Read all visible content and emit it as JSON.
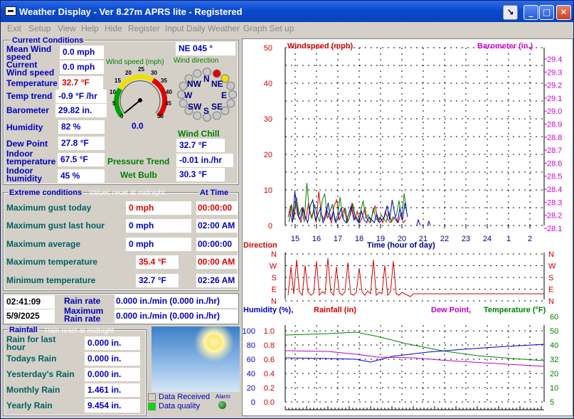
{
  "window": {
    "title": "Weather Display - Ver 8.27m APRS lite - Registered"
  },
  "menu": [
    "Exit",
    "Setup",
    "View",
    "Help",
    "Hide",
    "Register",
    "Input Daily Weather",
    "Graph Set up"
  ],
  "current": {
    "title": "Current Conditions",
    "mean_label": "Mean Wind speed",
    "mean": "0.0 mph",
    "current_label": "Current Wind speed",
    "current": "0.0 mph",
    "temp_label": "Temperature",
    "temp": "32.7 °F",
    "trend_label": "Temp trend",
    "trend": "-0.9 °F /hr",
    "baro_label": "Barometer",
    "baro": "29.82 in.",
    "hum_label": "Humidity",
    "hum": "82 %",
    "dew_label": "Dew Point",
    "dew": "27.8 °F",
    "itemp_label": "Indoor temperature",
    "itemp": "67.5 °F",
    "ihum_label": "Indoor humidity",
    "ihum": "45 %",
    "dir_value": "NE  045 °",
    "gauge_title": "Wind speed (mph)",
    "gauge_ticks": [
      "0",
      "5",
      "10",
      "15",
      "20",
      "25",
      "30",
      "35",
      "40",
      "45",
      "50"
    ],
    "gauge_value": "0.0",
    "dir_title": "Wind direction",
    "compass": [
      "N",
      "NE",
      "E",
      "SE",
      "S",
      "SW",
      "W",
      "NW"
    ],
    "chill_label": "Wind Chill",
    "chill": "32.7 °F",
    "ptrend_label": "Pressure Trend",
    "ptrend": "-0.01 in./hr",
    "wetbulb_label": "Wet Bulb",
    "wetbulb": "30.3 °F"
  },
  "extreme": {
    "title": "Extreme conditions",
    "note": "Values reset at midnight",
    "at_time": "At Time",
    "rows": [
      {
        "label": "Maximum gust today",
        "value": "0 mph",
        "time": "00:00:00",
        "vred": true,
        "tred": true
      },
      {
        "label": "Maximum gust last hour",
        "value": "0 mph",
        "time": "02:00 AM",
        "vred": false,
        "tred": false
      },
      {
        "label": "Maximum average",
        "value": "0 mph",
        "time": "00:00:00",
        "vred": false,
        "tred": false
      },
      {
        "label": "Maximum temperature",
        "value": "35.4 °F",
        "time": "00:00 AM",
        "vred": true,
        "tred": true
      },
      {
        "label": "Minimum temperature",
        "value": "32.7 °F",
        "time": "02:26 AM",
        "vred": false,
        "tred": false
      }
    ]
  },
  "clock": {
    "time": "02:41:09",
    "date": "5/9/2025"
  },
  "rainrate": {
    "label": "Rain rate",
    "value": "0.000 in./min (0.000 in./hr)",
    "max_label": "Maximum Rain rate",
    "max": "0.000 in./min (0.000 in./hr)"
  },
  "rainfall": {
    "title": "Rainfall",
    "note": "Rain reset at midnight",
    "rows": [
      {
        "label": "Rain for last hour",
        "value": "0.000 in."
      },
      {
        "label": "Todays Rain",
        "value": "0.000 in."
      },
      {
        "label": "Yesterday's Rain",
        "value": "0.000 in."
      },
      {
        "label": "Monthly Rain",
        "value": "1.461 in."
      },
      {
        "label": "Yearly Rain",
        "value": "9.454 in."
      }
    ]
  },
  "status": {
    "received": "Data Received",
    "quality": "Data quality",
    "alarm": "Alarm"
  },
  "graph": {
    "wind_label": "Windspeed (mph)",
    "baro_label": "Barometer (in.)",
    "wind_ticks": [
      "50",
      "40",
      "30",
      "20",
      "10",
      "0"
    ],
    "baro_ticks": [
      "29.4",
      "29.3",
      "29.2",
      "29.1",
      "29.0",
      "28.9",
      "28.8",
      "28.7",
      "28.6",
      "28.5",
      "28.4",
      "28.3",
      "28.2",
      "28.1"
    ],
    "hours": [
      "15",
      "16",
      "17",
      "18",
      "19",
      "20",
      "21",
      "22",
      "23",
      "24",
      "1",
      "2"
    ],
    "xlabel": "Time (hour of day)",
    "dir_label": "Direction",
    "dir_ticks": [
      "N",
      "W",
      "S",
      "E",
      "N"
    ],
    "hum_label": "Humidity (%),",
    "rain_label": "Rainfall (in)",
    "dew_label": "Dew Point,",
    "temp_label": "Temperature (°F)",
    "hum_ticks": [
      "100",
      "80",
      "60",
      "40",
      "20",
      "0"
    ],
    "rain_ticks": [
      "1.0",
      "0.8",
      "0.6",
      "0.4",
      "0.2",
      "0.0"
    ],
    "temp_ticks": [
      "60",
      "50",
      "40",
      "32",
      "20",
      "10",
      "5"
    ]
  },
  "colors": {
    "wind": "#D00000",
    "baro": "#D000D0",
    "temp": "#008000",
    "hum": "#0000C0",
    "dew": "#C000C0",
    "accent": "#0000C0"
  }
}
